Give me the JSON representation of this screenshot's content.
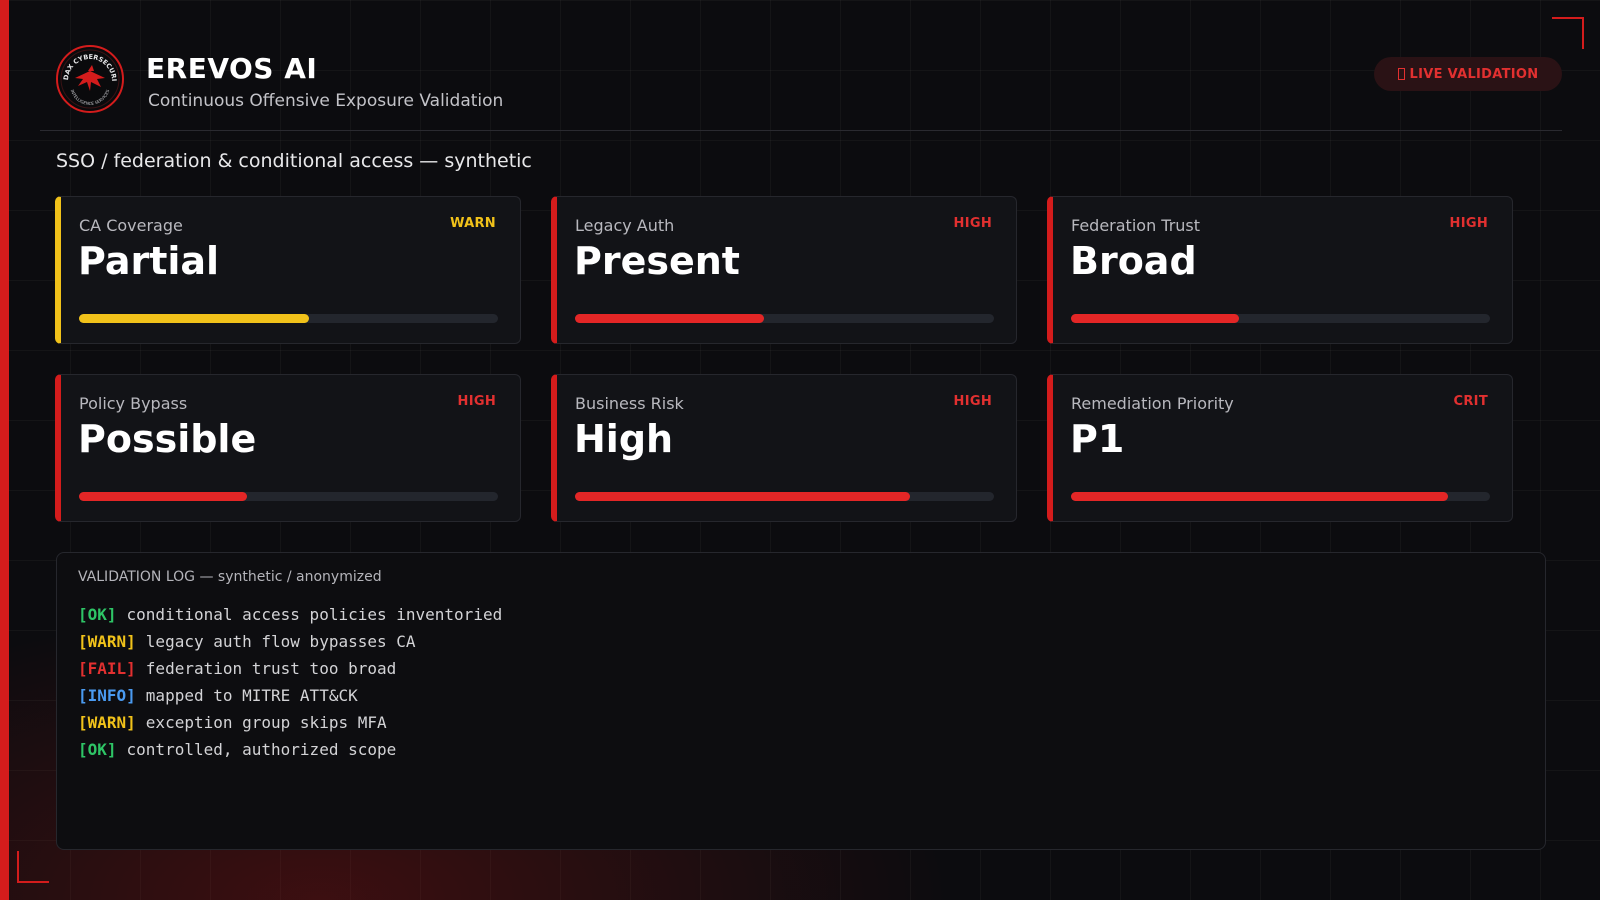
{
  "brand": {
    "title": "EREVOS AI",
    "subtitle": "Continuous Offensive Exposure Validation",
    "logo_text_top": "AUDAX CYBERSECURITY",
    "logo_text_bottom": "INTELLIGENCE SERVICES"
  },
  "live_badge": {
    "label": "LIVE VALIDATION",
    "icon": "live-indicator-icon"
  },
  "section_title": "SSO / federation & conditional access — synthetic",
  "cards": [
    {
      "label": "CA Coverage",
      "badge": "WARN",
      "value": "Partial",
      "level": 0.55
    },
    {
      "label": "Legacy Auth",
      "badge": "HIGH",
      "value": "Present",
      "level": 0.45
    },
    {
      "label": "Federation Trust",
      "badge": "HIGH",
      "value": "Broad",
      "level": 0.4
    },
    {
      "label": "Policy Bypass",
      "badge": "HIGH",
      "value": "Possible",
      "level": 0.4
    },
    {
      "label": "Business Risk",
      "badge": "HIGH",
      "value": "High",
      "level": 0.8
    },
    {
      "label": "Remediation Priority",
      "badge": "CRIT",
      "value": "P1",
      "level": 0.9
    }
  ],
  "log": {
    "title": "VALIDATION LOG — synthetic / anonymized",
    "lines": [
      {
        "tag": "[OK]",
        "text": "conditional access policies inventoried"
      },
      {
        "tag": "[WARN]",
        "text": "legacy auth flow bypasses CA"
      },
      {
        "tag": "[FAIL]",
        "text": "federation trust too broad"
      },
      {
        "tag": "[INFO]",
        "text": "mapped to MITRE ATT&CK"
      },
      {
        "tag": "[WARN]",
        "text": "exception group skips MFA"
      },
      {
        "tag": "[OK]",
        "text": "controlled, authorized scope"
      }
    ]
  },
  "colors": {
    "accent_red": "#d41c1c",
    "warn_yellow": "#f1c21a",
    "ok_green": "#2ec466",
    "info_blue": "#4a9af0",
    "background": "#0c0c0f"
  }
}
